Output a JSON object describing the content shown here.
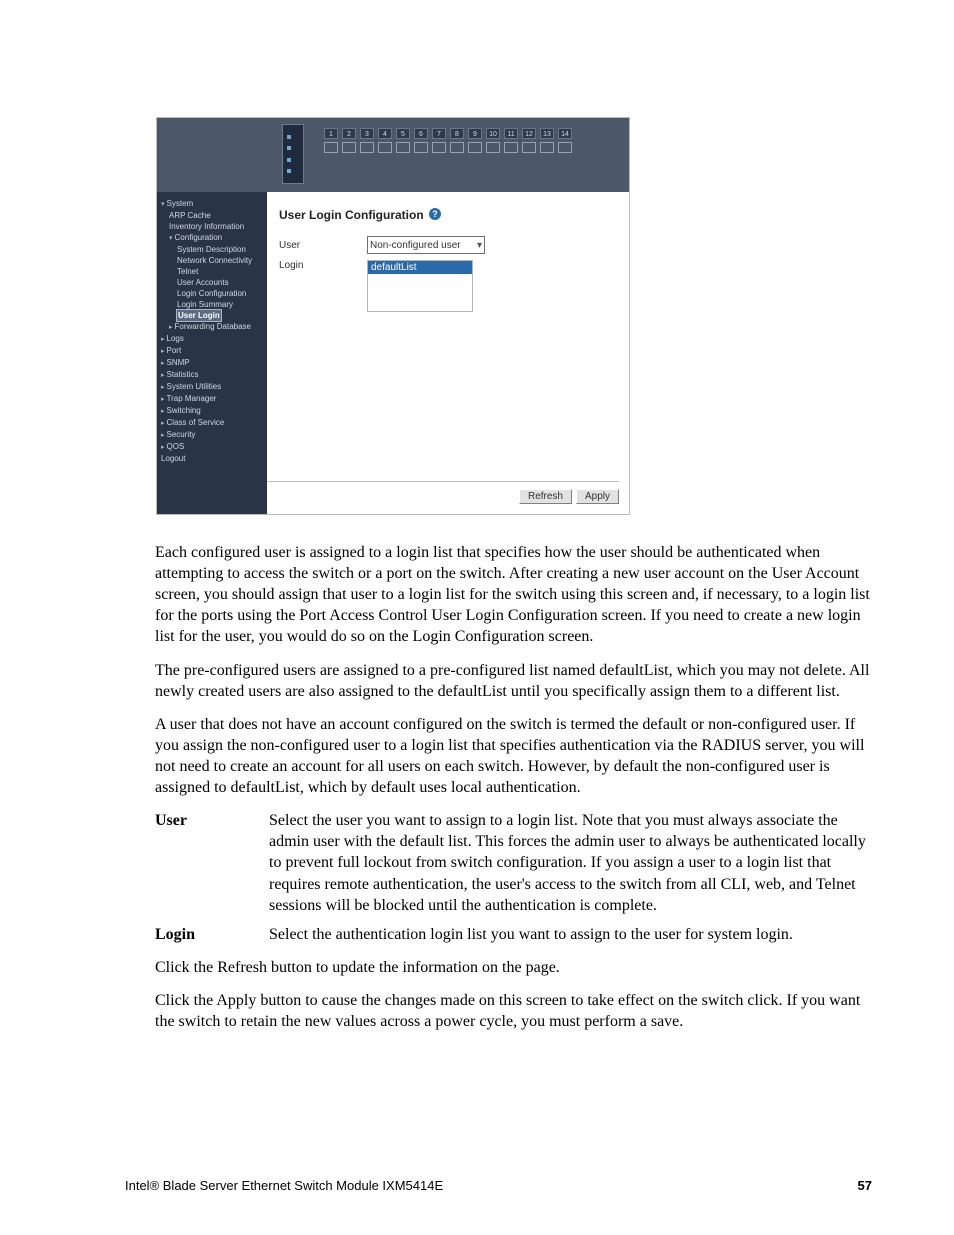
{
  "screenshot": {
    "ports": [
      "1",
      "2",
      "3",
      "4",
      "5",
      "6",
      "7",
      "8",
      "9",
      "10",
      "11",
      "12",
      "13",
      "14"
    ],
    "nav": [
      {
        "label": "System",
        "level": 0,
        "mark": "caret"
      },
      {
        "label": "ARP Cache",
        "level": 1
      },
      {
        "label": "Inventory Information",
        "level": 1
      },
      {
        "label": "Configuration",
        "level": 1,
        "mark": "caret"
      },
      {
        "label": "System Description",
        "level": 2
      },
      {
        "label": "Network Connectivity",
        "level": 2
      },
      {
        "label": "Telnet",
        "level": 2
      },
      {
        "label": "User Accounts",
        "level": 2
      },
      {
        "label": "Login Configuration",
        "level": 2
      },
      {
        "label": "Login Summary",
        "level": 2
      },
      {
        "label": "User Login",
        "level": 2,
        "highlight": true
      },
      {
        "label": "Forwarding Database",
        "level": 1,
        "mark": "arrow"
      },
      {
        "label": "Logs",
        "level": 0,
        "mark": "arrow"
      },
      {
        "label": "Port",
        "level": 0,
        "mark": "arrow"
      },
      {
        "label": "SNMP",
        "level": 0,
        "mark": "arrow"
      },
      {
        "label": "Statistics",
        "level": 0,
        "mark": "arrow"
      },
      {
        "label": "System Utilities",
        "level": 0,
        "mark": "arrow"
      },
      {
        "label": "Trap Manager",
        "level": 0,
        "mark": "arrow"
      },
      {
        "label": "Switching",
        "level": 0,
        "mark": "arrow"
      },
      {
        "label": "Class of Service",
        "level": 0,
        "mark": "arrow"
      },
      {
        "label": "Security",
        "level": 0,
        "mark": "arrow"
      },
      {
        "label": "QOS",
        "level": 0,
        "mark": "arrow"
      },
      {
        "label": "Logout",
        "level": 0
      }
    ],
    "panel_title": "User Login Configuration",
    "help_symbol": "?",
    "user_label": "User",
    "user_value": "Non-configured user",
    "login_label": "Login",
    "login_selected": "defaultList",
    "refresh_label": "Refresh",
    "apply_label": "Apply"
  },
  "doc": {
    "p1": "Each configured user is assigned to a login list that specifies how the user should be authenticated when attempting to access the switch or a port on the switch. After creating a new user account on the User Account screen, you should assign that user to a login list for the switch using this screen and, if necessary, to a login list for the ports using the Port Access Control User Login Configuration screen. If you need to create a new login list for the user, you would do so on the Login Configuration screen.",
    "p2": "The pre-configured users are assigned to a pre-configured list named defaultList, which you may not delete. All newly created users are also assigned to the defaultList until you specifically assign them to a different list.",
    "p3": "A user that does not have an account configured on the switch is termed the default or non-configured user. If you assign the non-configured user to a login list that specifies authentication via the RADIUS server, you will not need to create an account for all users on each switch. However, by default the non-configured user is assigned to defaultList, which by default uses local authentication.",
    "defs": {
      "user_term": "User",
      "user_def": "Select the user you want to assign to a login list. Note that you must always associate the admin user with the default list. This forces the admin user to always be authenticated locally to prevent full lockout from switch configuration. If you assign a user to a login list that requires remote authentication, the user's access to the switch from all CLI, web, and Telnet sessions will be blocked until the authentication is complete.",
      "login_term": "Login",
      "login_def": "Select the authentication login list you want to assign to the user for system login."
    },
    "p4": "Click the Refresh button to update the information on the page.",
    "p5": "Click the Apply button to cause the changes made on this screen to take effect on the switch click. If you want the switch to retain the new values across a power cycle, you must perform a save."
  },
  "footer": {
    "product": "Intel® Blade Server Ethernet Switch Module IXM5414E",
    "page": "57"
  }
}
